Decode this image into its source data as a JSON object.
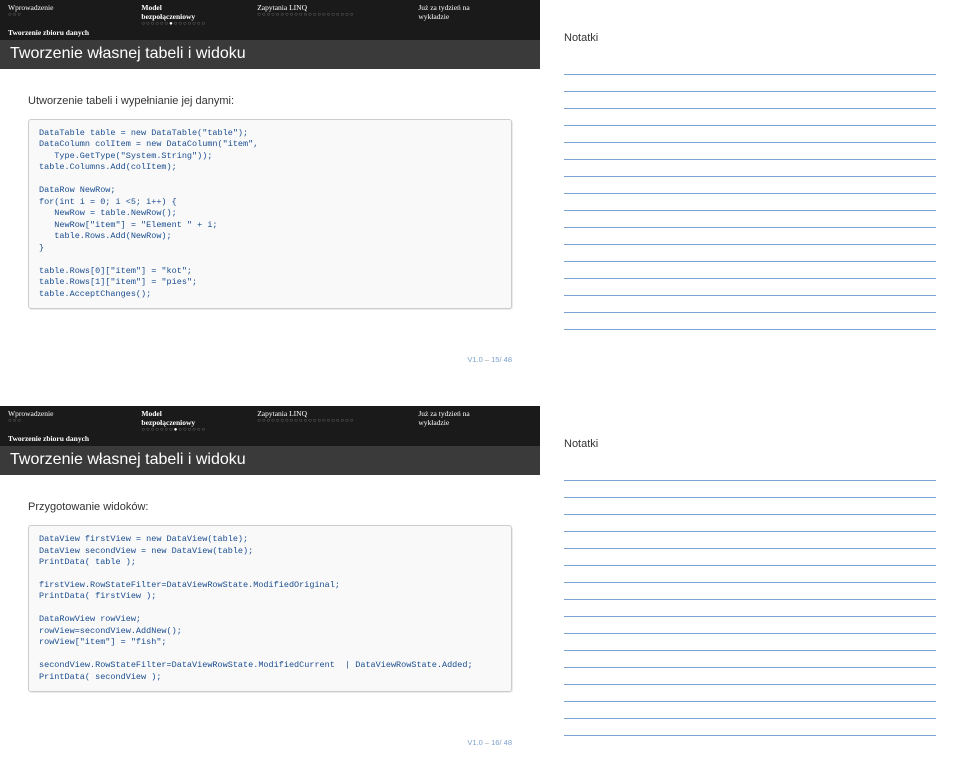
{
  "nav": {
    "items": [
      "Wprowadzenie",
      "Model bezpołączeniowy",
      "Zapytania LINQ",
      "Już za tydzień na wykładzie"
    ],
    "subsection": "Tworzenie zbioru danych"
  },
  "slide1": {
    "title": "Tworzenie własnej tabeli i widoku",
    "prompt": "Utworzenie tabeli i wypełnianie jej danymi:",
    "code": "DataTable table = new DataTable(\"table\");\nDataColumn colItem = new DataColumn(\"item\",\n   Type.GetType(\"System.String\"));\ntable.Columns.Add(colItem);\n\nDataRow NewRow;\nfor(int i = 0; i <5; i++) {\n   NewRow = table.NewRow();\n   NewRow[\"item\"] = \"Element \" + i;\n   table.Rows.Add(NewRow);\n}\n\ntable.Rows[0][\"item\"] = \"kot\";\ntable.Rows[1][\"item\"] = \"pies\";\ntable.AcceptChanges();",
    "footer_ver": "V1.0",
    "footer_page": "15/ 48"
  },
  "slide2": {
    "title": "Tworzenie własnej tabeli i widoku",
    "prompt": "Przygotowanie widoków:",
    "code": "DataView firstView = new DataView(table);\nDataView secondView = new DataView(table);\nPrintData( table );\n\nfirstView.RowStateFilter=DataViewRowState.ModifiedOriginal;\nPrintData( firstView );\n\nDataRowView rowView;\nrowView=secondView.AddNew();\nrowView[\"item\"] = \"fish\";\n\nsecondView.RowStateFilter=DataViewRowState.ModifiedCurrent  | DataViewRowState.Added;\nPrintData( secondView );",
    "footer_ver": "V1.0",
    "footer_page": "16/ 48"
  },
  "notes": {
    "title": "Notatki"
  }
}
